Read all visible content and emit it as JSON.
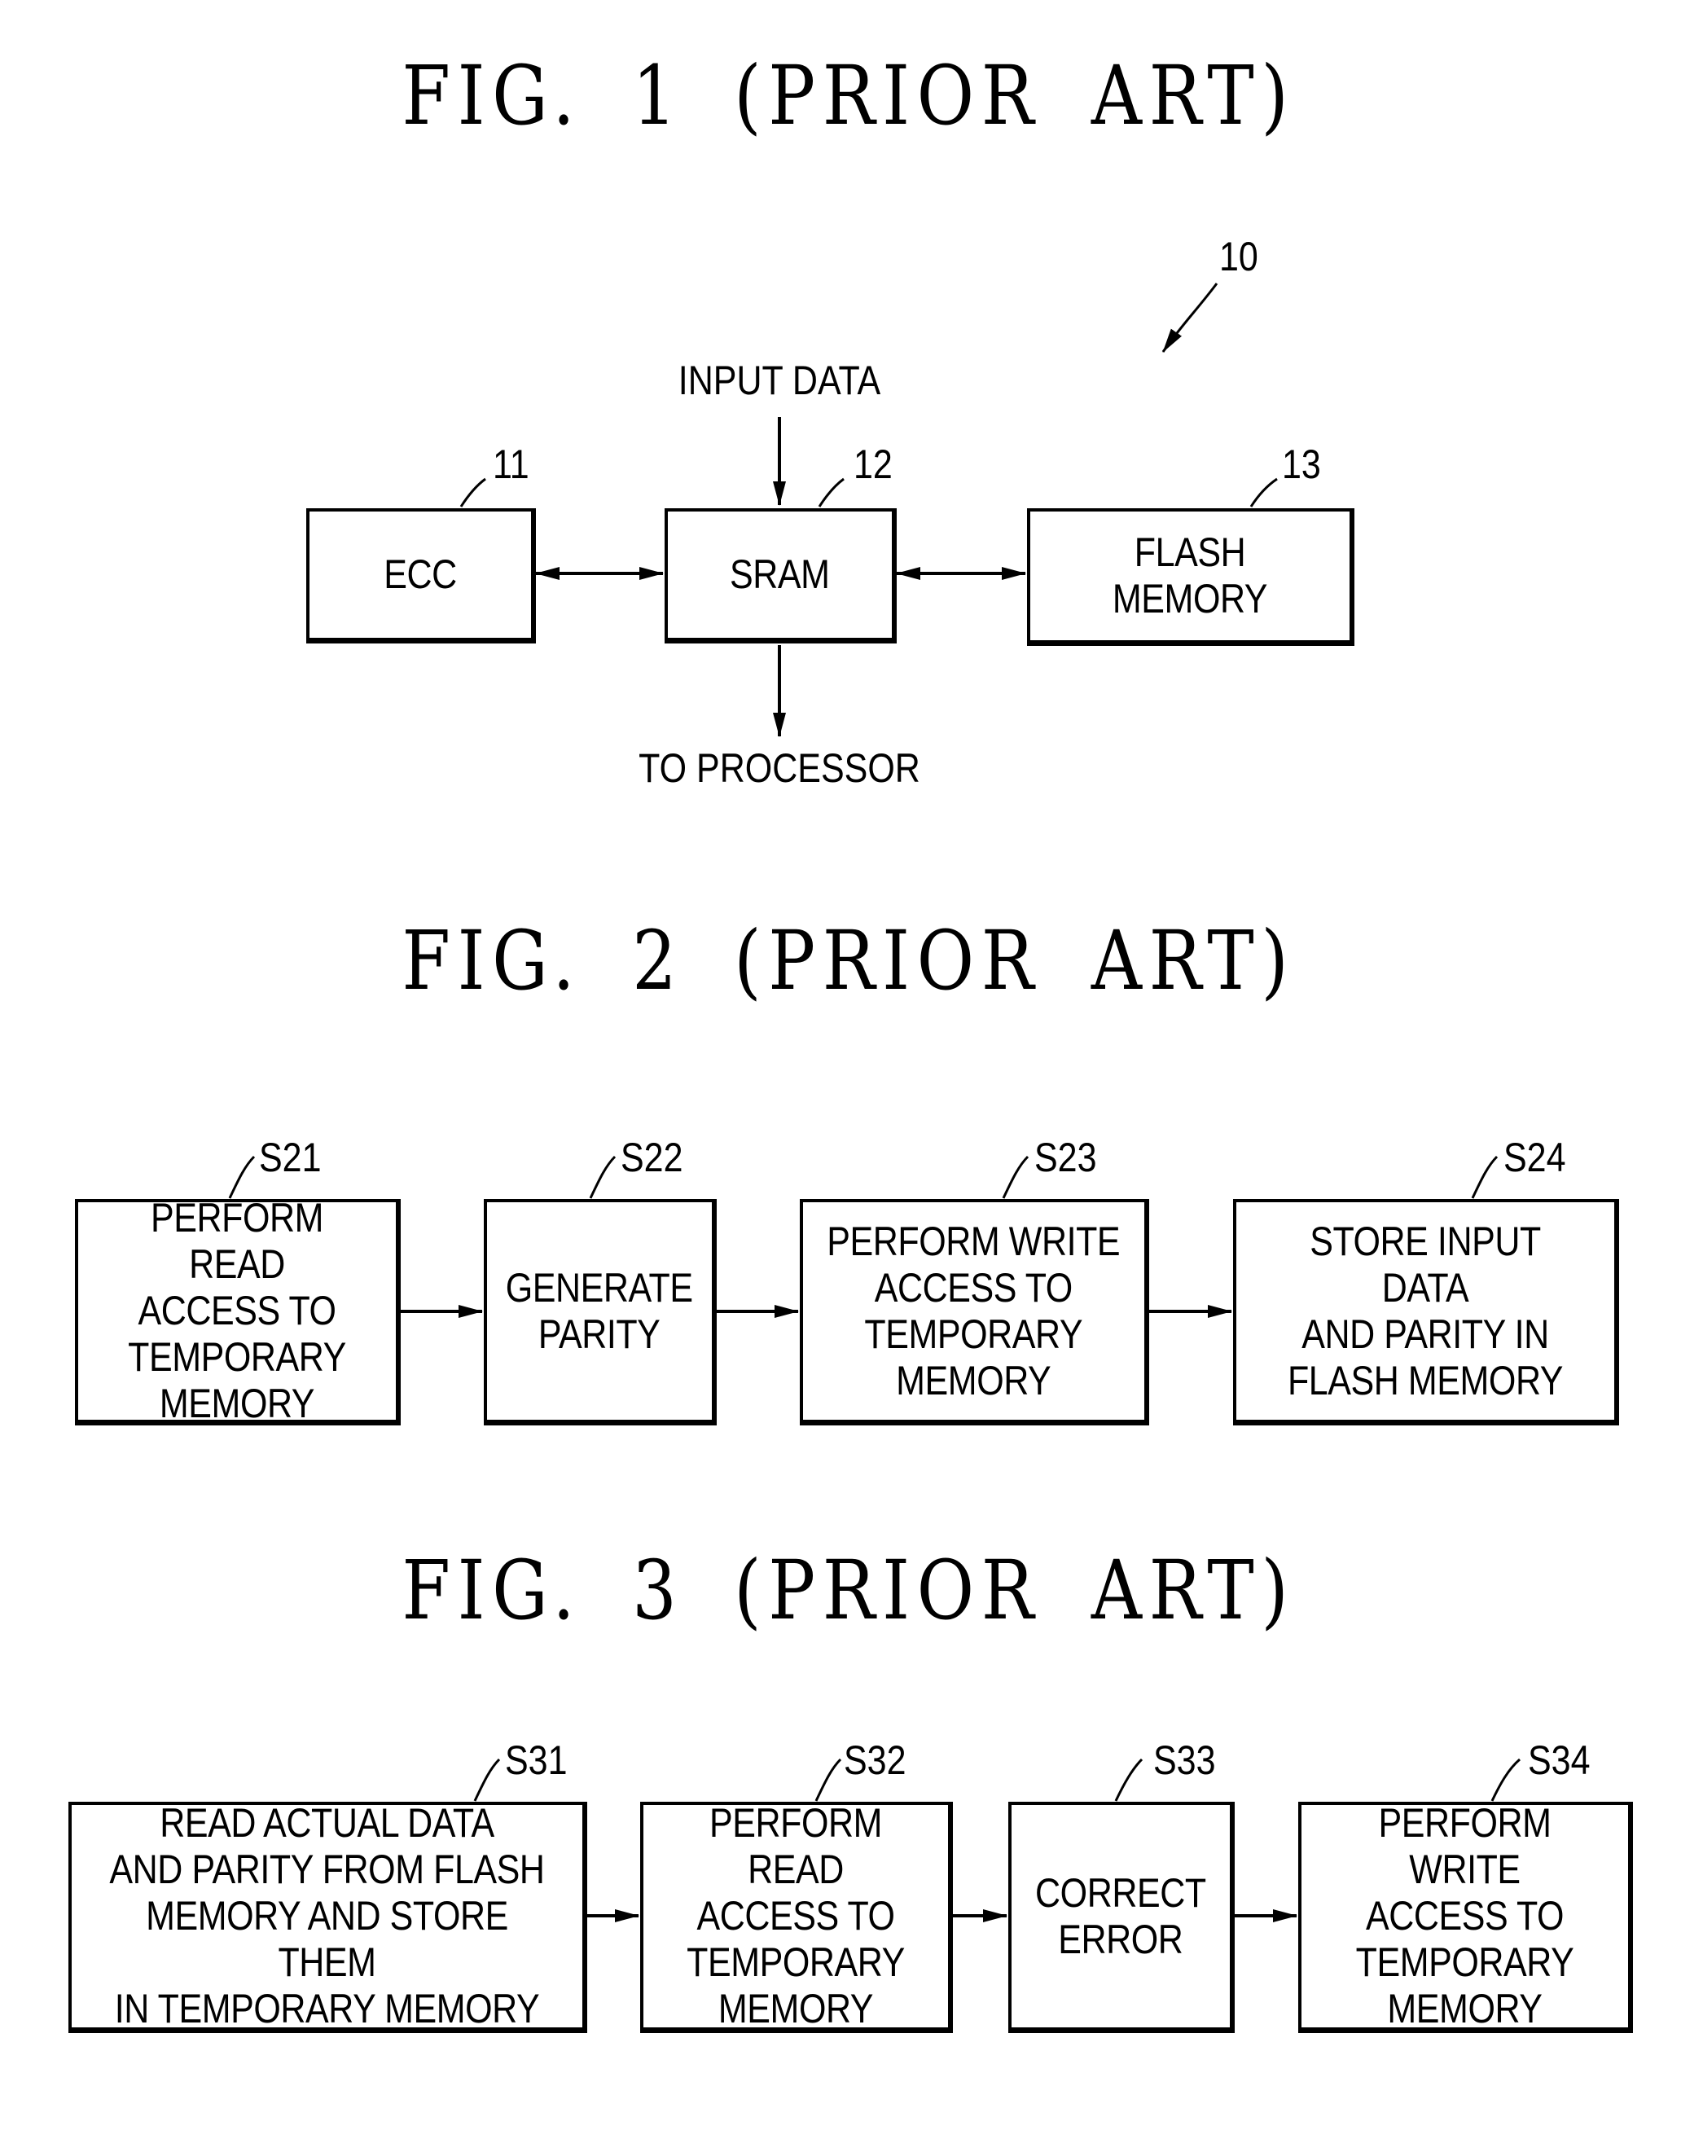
{
  "figures": [
    {
      "title": "FIG. 1 (PRIOR ART)",
      "reference": "10",
      "blocks": [
        {
          "ref": "11",
          "label": "ECC"
        },
        {
          "ref": "12",
          "label": "SRAM"
        },
        {
          "ref": "13",
          "label": "FLASH MEMORY"
        }
      ],
      "input_label": "INPUT DATA",
      "output_label": "TO PROCESSOR",
      "connections": [
        {
          "from": "ECC",
          "to": "SRAM",
          "type": "bidirectional"
        },
        {
          "from": "SRAM",
          "to": "FLASH MEMORY",
          "type": "bidirectional"
        },
        {
          "from": "INPUT DATA",
          "to": "SRAM",
          "type": "directed"
        },
        {
          "from": "SRAM",
          "to": "TO PROCESSOR",
          "type": "directed"
        }
      ]
    },
    {
      "title": "FIG. 2 (PRIOR ART)",
      "steps": [
        {
          "ref": "S21",
          "text": "PERFORM READ\nACCESS TO\nTEMPORARY\nMEMORY"
        },
        {
          "ref": "S22",
          "text": "GENERATE\nPARITY"
        },
        {
          "ref": "S23",
          "text": "PERFORM WRITE\nACCESS TO\nTEMPORARY\nMEMORY"
        },
        {
          "ref": "S24",
          "text": "STORE INPUT DATA\nAND PARITY IN\nFLASH MEMORY"
        }
      ]
    },
    {
      "title": "FIG. 3 (PRIOR ART)",
      "steps": [
        {
          "ref": "S31",
          "text": "READ ACTUAL DATA\nAND PARITY FROM FLASH\nMEMORY AND STORE THEM\nIN TEMPORARY MEMORY"
        },
        {
          "ref": "S32",
          "text": "PERFORM READ\nACCESS TO\nTEMPORARY\nMEMORY"
        },
        {
          "ref": "S33",
          "text": "CORRECT\nERROR"
        },
        {
          "ref": "S34",
          "text": "PERFORM WRITE\nACCESS TO\nTEMPORARY\nMEMORY"
        }
      ]
    }
  ]
}
